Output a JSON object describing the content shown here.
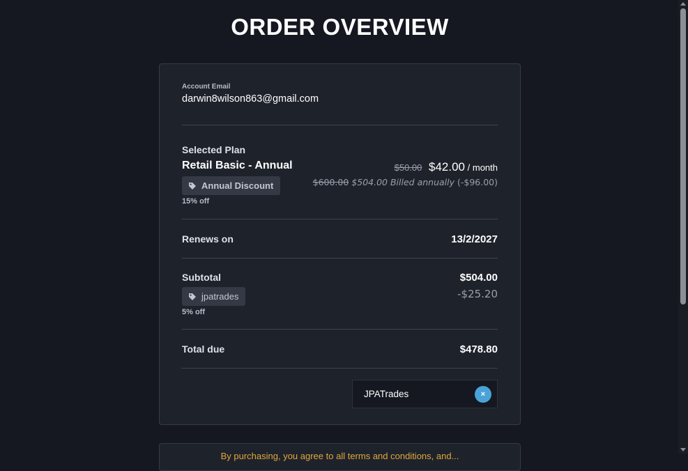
{
  "page": {
    "title": "ORDER OVERVIEW"
  },
  "account": {
    "label": "Account Email",
    "email": "darwin8wilson863@gmail.com"
  },
  "plan": {
    "label": "Selected Plan",
    "name": "Retail Basic - Annual",
    "discount_tag": "Annual Discount",
    "discount_off": "15% off",
    "old_monthly": "$50.00",
    "monthly": "$42.00",
    "monthly_unit": "/ month",
    "old_annual": "$600.00",
    "annual": "$504.00 Billed annually",
    "annual_savings": "(-$96.00)"
  },
  "renews": {
    "label": "Renews on",
    "date": "13/2/2027"
  },
  "subtotal": {
    "label": "Subtotal",
    "amount": "$504.00",
    "coupon_tag": "jpatrades",
    "coupon_off": "5% off",
    "coupon_discount": "-$25.20"
  },
  "total": {
    "label": "Total due",
    "amount": "$478.80"
  },
  "coupon_input": {
    "value": "JPATrades",
    "clear_label": "×"
  },
  "footer_card": {
    "text": "By purchasing, you agree to all terms and conditions, and..."
  },
  "icons": {
    "tag": "tag-icon",
    "clear": "close-icon"
  },
  "colors": {
    "accent": "#4aa3d8",
    "background": "#151820",
    "card": "#1e222b",
    "warning": "#e0a83a"
  }
}
